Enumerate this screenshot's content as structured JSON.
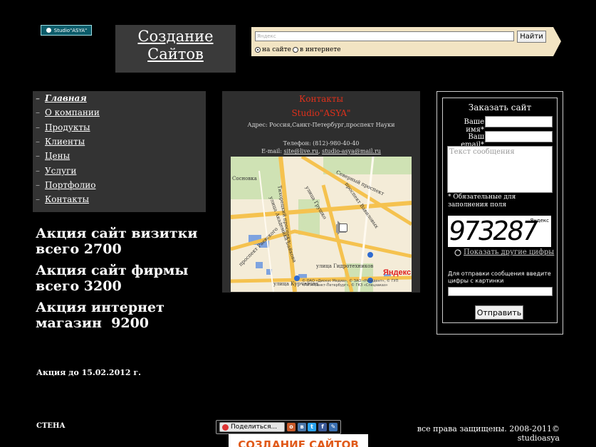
{
  "logo": {
    "text": "Studio\"ASYA\""
  },
  "header": {
    "title_line1": "Создание",
    "title_line2": "Сайтов"
  },
  "search": {
    "placeholder": "Яндекс",
    "button_label": "Найти",
    "options": [
      {
        "label": "на сайте",
        "selected": true
      },
      {
        "label": "в интернете",
        "selected": false
      }
    ]
  },
  "nav": {
    "items": [
      {
        "label": "Главная",
        "active": true
      },
      {
        "label": "О компании",
        "active": false
      },
      {
        "label": "Продукты",
        "active": false
      },
      {
        "label": "Клиенты",
        "active": false
      },
      {
        "label": "Цены",
        "active": false
      },
      {
        "label": "Услуги",
        "active": false
      },
      {
        "label": "Портфолио",
        "active": false
      },
      {
        "label": "Контакты",
        "active": false
      }
    ]
  },
  "promo": {
    "items": [
      {
        "line1": "Акция сайт визитки",
        "line2": "всего 2700"
      },
      {
        "line1": "Акция сайт фирмы",
        "line2": "всего 3200"
      },
      {
        "line1": "Акция интернет",
        "line2": "магазин  9200"
      }
    ],
    "until": "Акция до 15.02.2012 г."
  },
  "contacts": {
    "heading": "Контакты",
    "company": "Studio\"ASYA\"",
    "address": "Адрес: Россия,Санкт-Петербург,проспект Науки",
    "phone": "Телефон: (812)-980-40-40",
    "email_label": "E-mail: ",
    "email1": "site@live.ru",
    "email_sep": ", ",
    "email2": "studio-asya@mail.ru",
    "map": {
      "streets": [
        "Сосновка",
        "улица Академика Байкова",
        "Северный проспект",
        "Тихорецкий проспект",
        "проспект Раевского",
        "улица Гидротехников",
        "улица Курчатова",
        "проспект Вавиловых",
        "улица Грушко"
      ],
      "brand": "Яндекс",
      "credits": "© ОАО «Дискус Медиа», © ЗАО «Резидент», © ГУП «ГУГА Санкт-Петербург», © ГКЗ «Спецзаказ»"
    }
  },
  "order_form": {
    "title": "Заказать сайт",
    "name_label": "Ваше имя*",
    "email_label": "Ваш email*",
    "message_placeholder": "Текст сообщения",
    "required_note": "* Обязательные для заполнения поля",
    "captcha_value": "973287",
    "captcha_brand": "Яндекс",
    "show_other": "Показать другие цифры",
    "captcha_instruction": "Для отправки сообщения введите цифры с картинки",
    "submit_label": "Отправить"
  },
  "footer": {
    "wall": "СТЕНА",
    "share_label": "Поделиться...",
    "copyright_line1": "все права защищены. 2008-2011©",
    "copyright_line2": "studioasya",
    "banner_text": "СОЗДАНИЕ САЙТОВ"
  },
  "colors": {
    "background": "#000000",
    "panel": "#333333",
    "accent_red": "#e0301b",
    "search_panel": "#f2e4c3"
  }
}
